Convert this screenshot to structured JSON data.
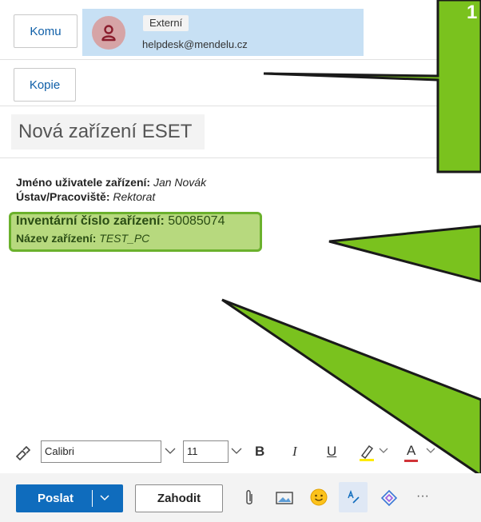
{
  "recipients": {
    "to_label": "Komu",
    "cc_label": "Kopie",
    "to_chip": {
      "badge": "Externí",
      "email": "helpdesk@mendelu.cz"
    }
  },
  "subject": "Nová zařízení ESET",
  "body": {
    "line1": {
      "label": "Jméno uživatele zařízení:",
      "value": "Jan Novák"
    },
    "line2": {
      "label": "Ústav/Pracoviště:",
      "value": "Rektorat"
    },
    "line3": {
      "label": "Inventární číslo zařízení:",
      "value": "50085074"
    },
    "line4": {
      "label": "Název zařízení:",
      "value": "TEST_PC"
    }
  },
  "toolbar": {
    "font": "Calibri",
    "size": "11",
    "bold": "B",
    "italic": "I",
    "underline": "U",
    "font_color": "A"
  },
  "actions": {
    "send": "Poslat",
    "discard": "Zahodit",
    "more": "···"
  },
  "callout_marker": "1",
  "colors": {
    "accent": "#0f6cbd",
    "callout": "#7ac21e",
    "highlight": "#b7d97e",
    "chip": "#c7e0f4"
  }
}
